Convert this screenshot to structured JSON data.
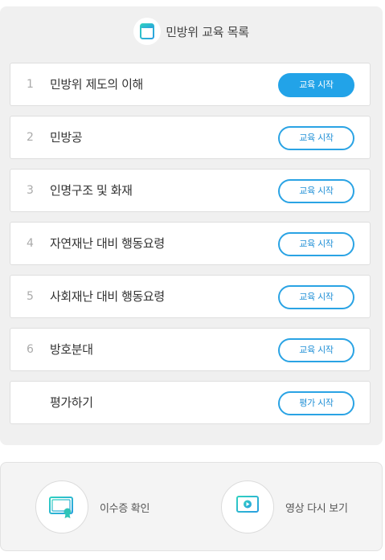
{
  "header": {
    "title": "민방위 교육 목록",
    "icon": "document-list-icon"
  },
  "courses": [
    {
      "num": "1",
      "title": "민방위 제도의 이해",
      "button": "교육 시작",
      "active": true
    },
    {
      "num": "2",
      "title": "민방공",
      "button": "교육 시작",
      "active": false
    },
    {
      "num": "3",
      "title": "인명구조 및 화재",
      "button": "교육 시작",
      "active": false
    },
    {
      "num": "4",
      "title": "자연재난 대비 행동요령",
      "button": "교육 시작",
      "active": false
    },
    {
      "num": "5",
      "title": "사회재난 대비 행동요령",
      "button": "교육 시작",
      "active": false
    },
    {
      "num": "6",
      "title": "방호분대",
      "button": "교육 시작",
      "active": false
    },
    {
      "num": "",
      "title": "평가하기",
      "button": "평가 시작",
      "active": false
    }
  ],
  "actions": {
    "certificate": {
      "label": "이수증 확인",
      "icon": "certificate-icon"
    },
    "replay": {
      "label": "영상 다시 보기",
      "icon": "monitor-play-icon"
    }
  },
  "colors": {
    "accent": "#22a3e8",
    "icon_teal": "#1fbfb8"
  }
}
